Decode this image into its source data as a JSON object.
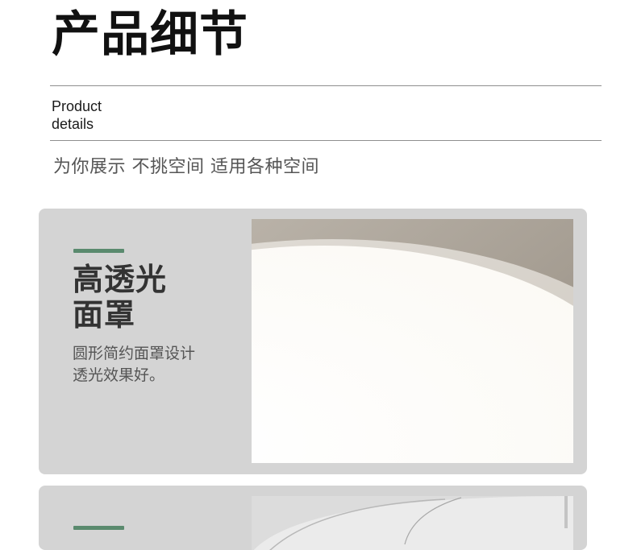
{
  "header": {
    "title": "产品细节",
    "subtitle_en_line1": "Product",
    "subtitle_en_line2": "details",
    "tagline": "为你展示 不挑空间 适用各种空间"
  },
  "features": [
    {
      "title_line1": "高透光",
      "title_line2": "面罩",
      "desc_line1": "圆形简约面罩设计",
      "desc_line2": "透光效果好。"
    }
  ],
  "colors": {
    "accent": "#5a8a6e",
    "card_bg": "#d4d4d4",
    "title": "#111111",
    "tagline": "#555555"
  }
}
